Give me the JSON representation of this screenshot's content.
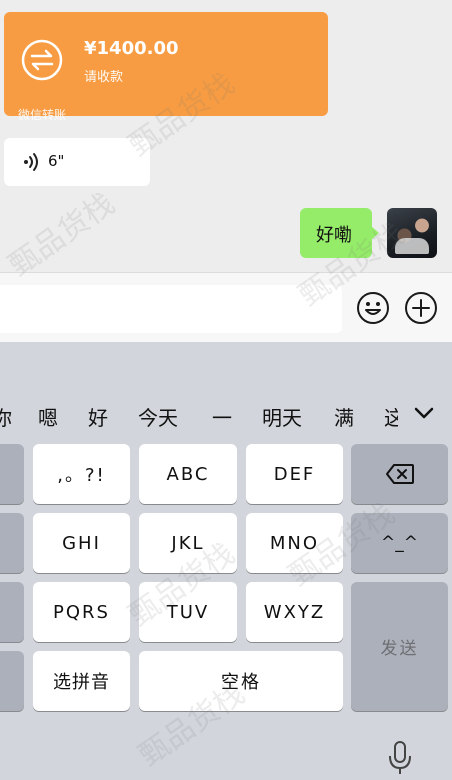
{
  "chat": {
    "transfer": {
      "amount": "¥1400.00",
      "subtitle": "请收款",
      "footer": "微信转账"
    },
    "voice": {
      "duration": "6\""
    },
    "outgoing_message": "好嘞"
  },
  "keyboard": {
    "candidates": [
      "你",
      "嗯",
      "好",
      "今天",
      "一",
      "明天",
      "满",
      "这"
    ],
    "rows": [
      [
        ",。?!",
        "ABC",
        "DEF"
      ],
      [
        "GHI",
        "JKL",
        "MNO"
      ],
      [
        "PQRS",
        "TUV",
        "WXYZ"
      ]
    ],
    "emoticon_key": "^_^",
    "pinyin_key": "选拼音",
    "space_key": "空格",
    "send_key": "发送"
  },
  "watermark": "甄品货栈",
  "colors": {
    "transfer_orange": "#f79c42",
    "bubble_green": "#95ec69",
    "keyboard_bg": "#d2d5db",
    "key_gray": "#abb0ba"
  }
}
